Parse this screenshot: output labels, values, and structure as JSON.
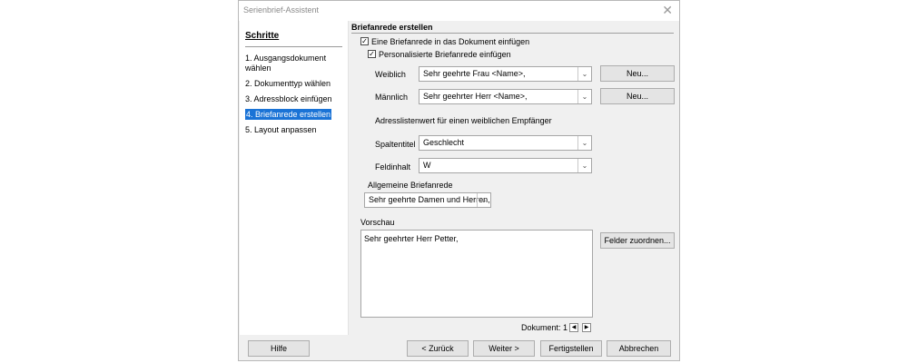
{
  "window": {
    "title": "Serienbrief-Assistent",
    "close_icon": "✕"
  },
  "sidebar": {
    "heading": "Schritte",
    "steps": [
      {
        "label": "1. Ausgangsdokument wählen",
        "selected": false
      },
      {
        "label": "2. Dokumenttyp wählen",
        "selected": false
      },
      {
        "label": "3. Adressblock einfügen",
        "selected": false
      },
      {
        "label": "4. Briefanrede erstellen",
        "selected": true
      },
      {
        "label": "5. Layout anpassen",
        "selected": false
      }
    ]
  },
  "main": {
    "section_title": "Briefanrede erstellen",
    "insert_salutation": {
      "label": "Eine Briefanrede in das Dokument einfügen",
      "checked": true
    },
    "personalized": {
      "label": "Personalisierte Briefanrede einfügen",
      "checked": true
    },
    "female": {
      "label": "Weiblich",
      "value": "Sehr geehrte Frau <Name>,",
      "new_button": "Neu..."
    },
    "male": {
      "label": "Männlich",
      "value": "Sehr geehrter Herr <Name>,",
      "new_button": "Neu..."
    },
    "address_list_note": "Adresslistenwert für einen weiblichen Empfänger",
    "column_title": {
      "label": "Spaltentitel",
      "value": "Geschlecht"
    },
    "field_content": {
      "label": "Feldinhalt",
      "value": "W"
    },
    "general_salutation": {
      "label": "Allgemeine Briefanrede",
      "value": "Sehr geehrte Damen und Herren,"
    },
    "preview": {
      "label": "Vorschau",
      "text": "Sehr geehrter Herr Petter,",
      "assign_fields_button": "Felder zuordnen..."
    },
    "document_nav": {
      "label": "Dokument: 1",
      "prev_icon": "◀",
      "next_icon": "▶"
    }
  },
  "footer": {
    "help": "Hilfe",
    "back": "< Zurück",
    "next": "Weiter >",
    "finish": "Fertigstellen",
    "cancel": "Abbrechen"
  },
  "icons": {
    "check": "✓",
    "dropdown": "⌄"
  }
}
